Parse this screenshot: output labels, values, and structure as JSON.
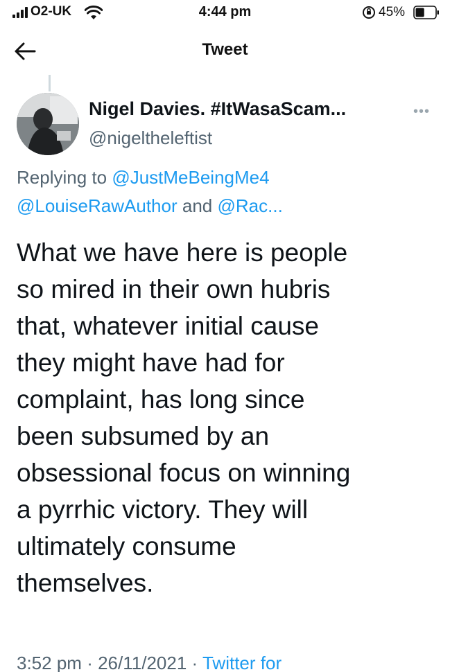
{
  "status_bar": {
    "carrier": "O2-UK",
    "time": "4:44 pm",
    "battery_percent": "45%",
    "battery_level": 0.45
  },
  "nav": {
    "title": "Tweet",
    "back_icon": "arrow-left-icon"
  },
  "tweet": {
    "display_name": "Nigel Davies. #ItWasaScam...",
    "handle": "@nigeltheleftist",
    "more_icon": "more-horizontal-icon",
    "replying_to_label": "Replying to",
    "reply_user_1": "@JustMeBeingMe4",
    "reply_user_2": "@LouiseRawAuthor",
    "reply_and": "and",
    "reply_user_3": "@Rac...",
    "text": "What we have here is people\nso mired in their own hubris\nthat, whatever initial cause\nthey might have had for\ncomplaint, has long since\nbeen subsumed by an\nobsessional focus on winning\na pyrrhic victory. They will\nultimately consume\nthemselves.",
    "time": "3:52 pm",
    "date": "26/11/2021",
    "separator": "·",
    "source": "Twitter for"
  },
  "colors": {
    "link": "#1d9bf0",
    "secondary_text": "#536471",
    "primary_text": "#0f1419"
  }
}
